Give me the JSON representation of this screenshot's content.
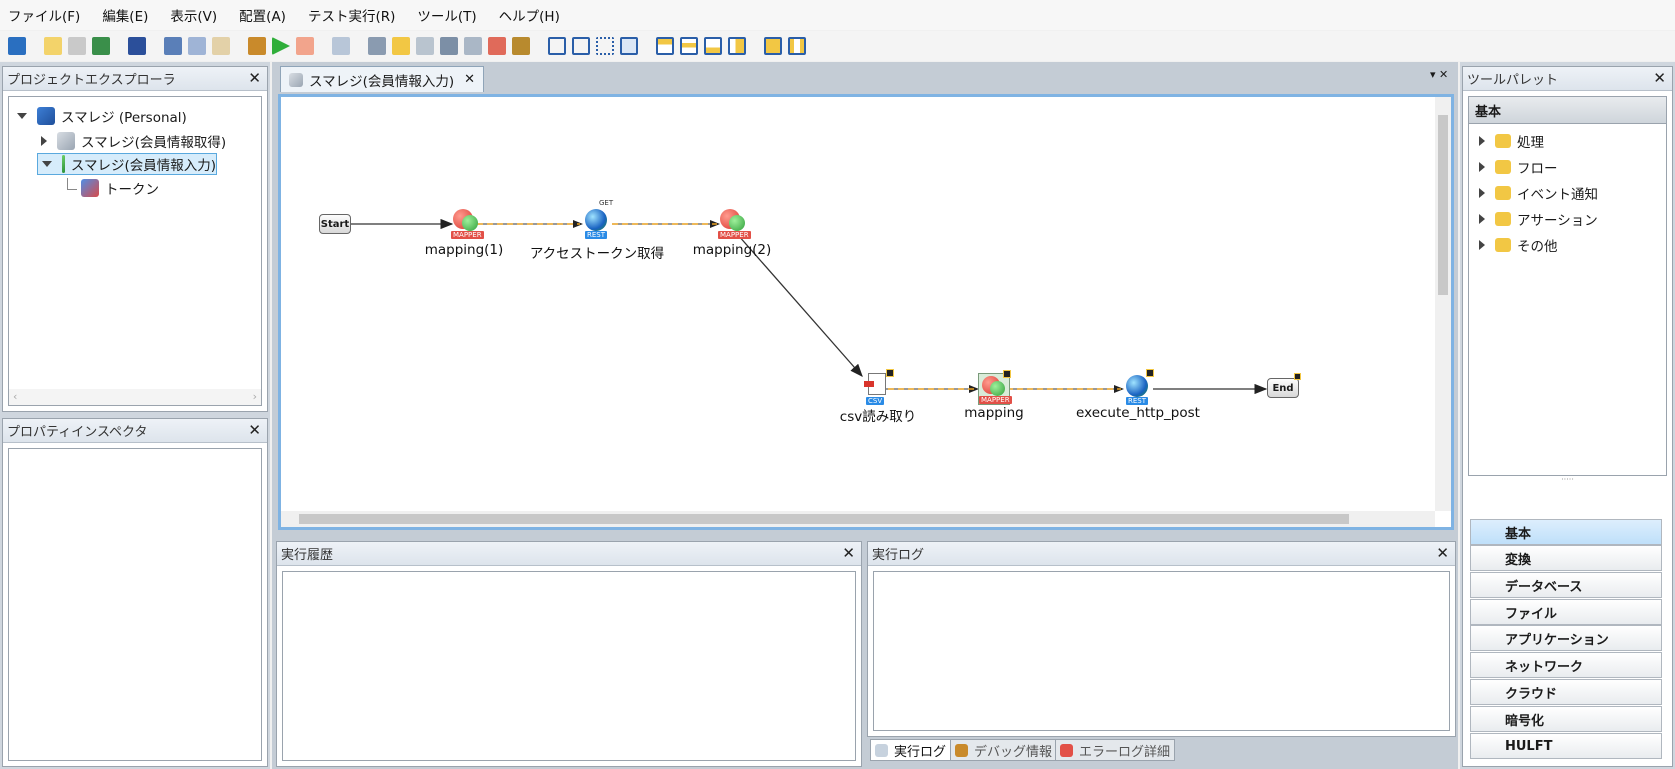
{
  "menu": [
    "ファイル(F)",
    "編集(E)",
    "表示(V)",
    "配置(A)",
    "テスト実行(R)",
    "ツール(T)",
    "ヘルプ(H)"
  ],
  "explorer": {
    "title": "プロジェクトエクスプローラ",
    "close": "✕",
    "items": [
      {
        "label": "スマレジ (Personal)"
      },
      {
        "label": "スマレジ(会員情報取得)"
      },
      {
        "label": "スマレジ(会員情報入力)"
      },
      {
        "label": "トークン"
      }
    ]
  },
  "properties": {
    "title": "プロパティインスペクタ",
    "close": "✕"
  },
  "editor": {
    "tab_label": "スマレジ(会員情報入力)",
    "tab_close": "✕",
    "nodes": {
      "start": "Start",
      "end": "End",
      "mapping1": "mapping(1)",
      "token": "アクセストークン取得",
      "mapping2": "mapping(2)",
      "csv": "csv読み取り",
      "mapping": "mapping",
      "post": "execute_http_post"
    },
    "badges": {
      "mapper": "MAPPER",
      "rest": "REST",
      "csv": "CSV",
      "get": "GET"
    }
  },
  "history": {
    "title": "実行履歴",
    "close": "✕"
  },
  "log": {
    "title": "実行ログ",
    "close": "✕"
  },
  "bottom_tabs": [
    "実行ログ",
    "デバッグ情報",
    "エラーログ詳細"
  ],
  "palette": {
    "title": "ツールパレット",
    "close": "✕",
    "section": "基本",
    "folders": [
      "処理",
      "フロー",
      "イベント通知",
      "アサーション",
      "その他"
    ],
    "groups": [
      "基本",
      "変換",
      "データベース",
      "ファイル",
      "アプリケーション",
      "ネットワーク",
      "クラウド",
      "暗号化",
      "HULFT"
    ]
  },
  "colors": {
    "accent": "#7fb3e3",
    "selection": "#d6ecfb",
    "folder": "#f2c744",
    "flow_dash": "#e8a020"
  }
}
